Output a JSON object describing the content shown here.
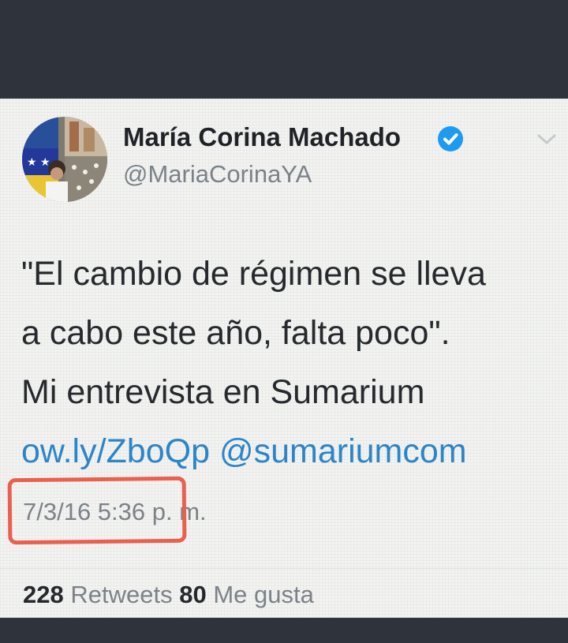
{
  "tweet": {
    "author_name": "María Corina Machado",
    "handle": "@MariaCorinaYA",
    "verified_icon": "verified-badge-icon",
    "text_lines": [
      "\"El cambio de régimen se lleva",
      "a cabo este año, falta poco\".",
      "Mi entrevista en Sumarium",
      "ow.ly/ZboQp @sumariumcom"
    ],
    "link_color": "#2c85c8",
    "timestamp": "7/3/16 5:36 p. m.",
    "highlight_color": "#e9604f",
    "retweets_count": "228",
    "retweets_label": "Retweets",
    "likes_count": "80",
    "likes_label": "Me gusta"
  }
}
